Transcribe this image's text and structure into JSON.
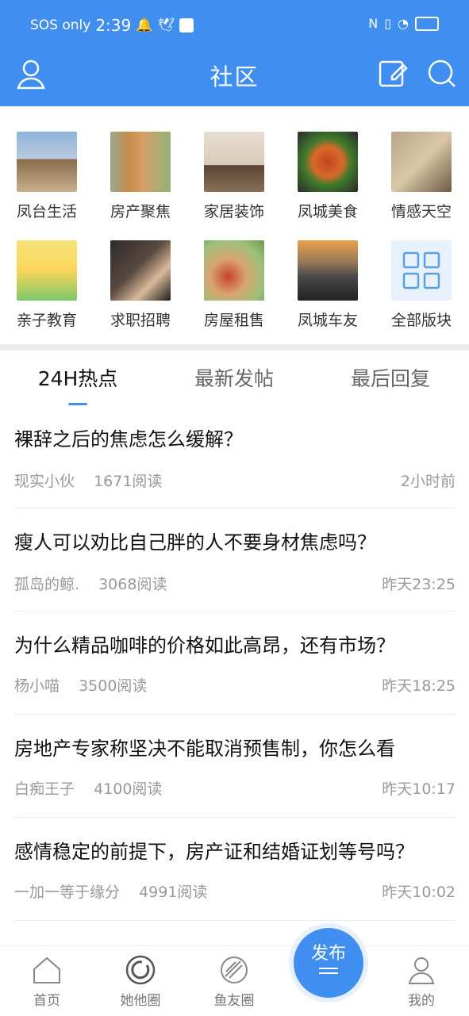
{
  "status_bar": {
    "carrier": "SOS only",
    "time": "2:39"
  },
  "header": {
    "title": "社区"
  },
  "colors": {
    "accent": "#3f8ef0"
  },
  "categories": [
    {
      "label": "凤台生活",
      "icon": "city-building-image"
    },
    {
      "label": "房产聚焦",
      "icon": "apartment-towers-image"
    },
    {
      "label": "家居装饰",
      "icon": "dining-room-image"
    },
    {
      "label": "凤城美食",
      "icon": "food-plate-image"
    },
    {
      "label": "情感天空",
      "icon": "woman-lakeside-image"
    },
    {
      "label": "亲子教育",
      "icon": "family-cartoon-image"
    },
    {
      "label": "求职招聘",
      "icon": "handshake-image"
    },
    {
      "label": "房屋租售",
      "icon": "house-key-image"
    },
    {
      "label": "凤城车友",
      "icon": "car-dashboard-image"
    },
    {
      "label": "全部版块",
      "icon": "grid-icon"
    }
  ],
  "tabs": [
    {
      "label": "24H热点",
      "active": true
    },
    {
      "label": "最新发帖",
      "active": false
    },
    {
      "label": "最后回复",
      "active": false
    }
  ],
  "posts": [
    {
      "title": "裸辞之后的焦虑怎么缓解？",
      "author": "现实小伙",
      "reads": "1671阅读",
      "time": "2小时前"
    },
    {
      "title": "瘦人可以劝比自己胖的人不要身材焦虑吗？",
      "author": "孤岛的鲸.",
      "reads": "3068阅读",
      "time": "昨天23:25"
    },
    {
      "title": "为什么精品咖啡的价格如此高昂，还有市场？",
      "author": "杨小喵",
      "reads": "3500阅读",
      "time": "昨天18:25"
    },
    {
      "title": "房地产专家称坚决不能取消预售制，你怎么看",
      "author": "白痴王子",
      "reads": "4100阅读",
      "time": "昨天10:17"
    },
    {
      "title": "感情稳定的前提下，房产证和结婚证划等号吗？",
      "author": "一加一等于缘分",
      "reads": "4991阅读",
      "time": "昨天10:02"
    }
  ],
  "bottom_nav": [
    {
      "label": "首页"
    },
    {
      "label": "她他圈"
    },
    {
      "label": "鱼友圈"
    },
    {
      "label": "我的"
    }
  ],
  "fab": {
    "label": "发布"
  }
}
